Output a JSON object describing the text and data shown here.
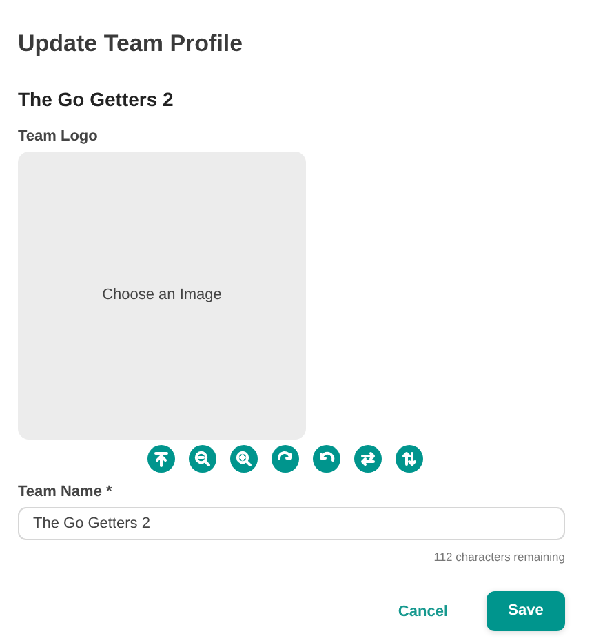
{
  "dialog": {
    "title": "Update Team Profile"
  },
  "team_heading": "The Go Getters 2",
  "logo": {
    "label": "Team Logo",
    "prompt": "Choose an Image"
  },
  "team_name": {
    "label": "Team Name *",
    "value": "The Go Getters 2",
    "hint": "112 characters remaining"
  },
  "buttons": [
    {
      "label": "Cancel",
      "kind": "text"
    },
    {
      "label": "Save",
      "kind": "primary"
    }
  ]
}
